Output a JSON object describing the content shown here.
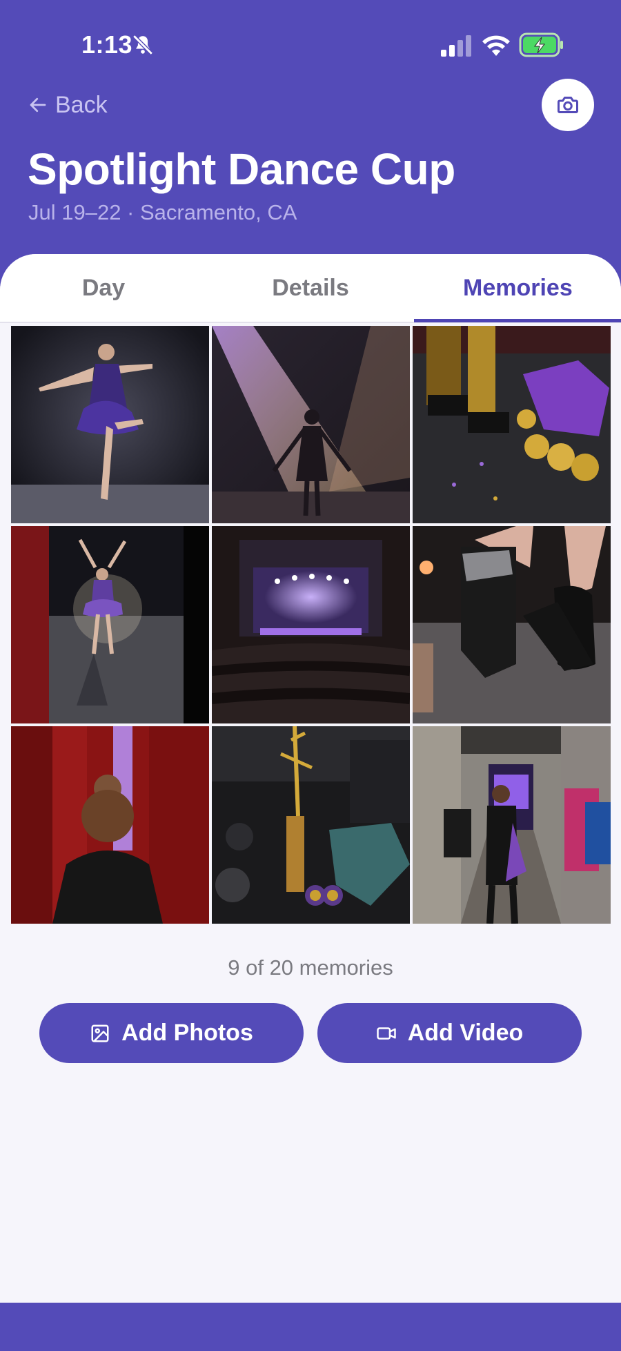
{
  "status_bar": {
    "time": "1:13",
    "icons": [
      "bell-slash-icon",
      "signal-icon",
      "wifi-icon",
      "battery-charging-icon"
    ]
  },
  "header": {
    "back_label": "Back",
    "title": "Spotlight Dance Cup",
    "subtitle": "Jul 19–22 · Sacramento, CA",
    "camera_icon": "camera-icon"
  },
  "tabs": [
    {
      "label": "Day",
      "selected": false
    },
    {
      "label": "Details",
      "selected": false
    },
    {
      "label": "Memories",
      "selected": true
    }
  ],
  "memories": {
    "count_text": "9 of 20 memories",
    "photos": [
      "dancer-on-stage",
      "silhouette-in-spotlight",
      "trophies-and-medals",
      "dancer-arms-raised-stage",
      "theater-stage-lights",
      "tap-shoes-closeup",
      "dancer-behind-curtain",
      "trophy-in-car",
      "dancer-backstage-hallway"
    ]
  },
  "actions": {
    "add_photos_label": "Add Photos",
    "add_video_label": "Add Video"
  },
  "colors": {
    "brand": "#544bb8",
    "accent_text": "#4e44b4",
    "background": "#f6f5fb"
  }
}
